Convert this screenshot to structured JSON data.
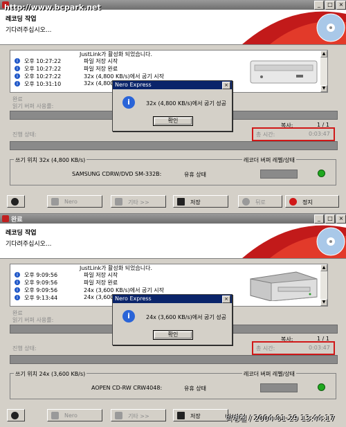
{
  "watermark_top": "http://www.bcpark.net",
  "watermark_bottom": "박병철 / 2004-01-29 13:44:17",
  "colors": {
    "title_gradient_top": "#9a9a9a",
    "highlight_red": "#d01818",
    "dialog_title": "#0a246a",
    "led_green": "#1fa81f"
  },
  "panels": [
    {
      "window_title": "",
      "header_title": "레코딩 작업",
      "header_subtitle": "기다려주십시오...",
      "log": [
        {
          "time": "",
          "message": "JustLink가 활성화 되었습니다."
        },
        {
          "time": "오후 10:27:22",
          "message": "파일 저장 시작"
        },
        {
          "time": "오후 10:27:22",
          "message": "파일 저장 완료"
        },
        {
          "time": "오후 10:27:22",
          "message": "32x (4,800 KB/s)에서 굽기 시작"
        },
        {
          "time": "오후 10:31:10",
          "message": "32x (4,800 K"
        }
      ],
      "done_label": "완료",
      "buffer_label": "읽기 버퍼 사용률:",
      "copy_label": "복사:",
      "copy_value": "1 / 1",
      "progress_label": "진행 상태:",
      "total_time_label": "총 시간:",
      "total_time_value": "0:03:47",
      "write_speed": "쓰기 위치 32x (4,800 KB/s)",
      "recorder_label": "레코더 버퍼 레벨/상태",
      "drive_name": "SAMSUNG CDRW/DVD SM-332B:",
      "drive_status": "유휴 상태",
      "dialog": {
        "title": "Nero Express",
        "message": "32x (4,800 KB/s)에서 굽기 성공",
        "ok": "확인"
      },
      "buttons": {
        "nero": "Nero",
        "more": "기타 >>",
        "save": "저장",
        "back": "뒤로",
        "stop": "정지"
      }
    },
    {
      "window_title": "완료",
      "header_title": "레코딩 작업",
      "header_subtitle": "기다려주십시오...",
      "log": [
        {
          "time": "",
          "message": "JustLink가 활성화 되었습니다."
        },
        {
          "time": "오후 9:09:56",
          "message": "파일 저장 시작"
        },
        {
          "time": "오후 9:09:56",
          "message": "파일 저장 완료"
        },
        {
          "time": "오후 9:09:56",
          "message": "24x (3,600 KB/s)에서 굽기 시작"
        },
        {
          "time": "오후 9:13:44",
          "message": "24x (3,600 K"
        }
      ],
      "done_label": "완료",
      "buffer_label": "읽기 버퍼 사용률:",
      "copy_label": "복사:",
      "copy_value": "1 / 1",
      "progress_label": "진행 상태:",
      "total_time_label": "총 시간:",
      "total_time_value": "0:03:47",
      "write_speed": "쓰기 위치 24x (3,600 KB/s)",
      "recorder_label": "레코더 버퍼 레벨/상태",
      "drive_name": "AOPEN CD-RW CRW4048:",
      "drive_status": "유휴 상태",
      "dialog": {
        "title": "Nero Express",
        "message": "24x (3,600 KB/s)에서 굽기 성공",
        "ok": "확인"
      },
      "buttons": {
        "nero": "Nero",
        "more": "기타 >>",
        "save": "저장",
        "back": "",
        "stop": ""
      }
    }
  ]
}
